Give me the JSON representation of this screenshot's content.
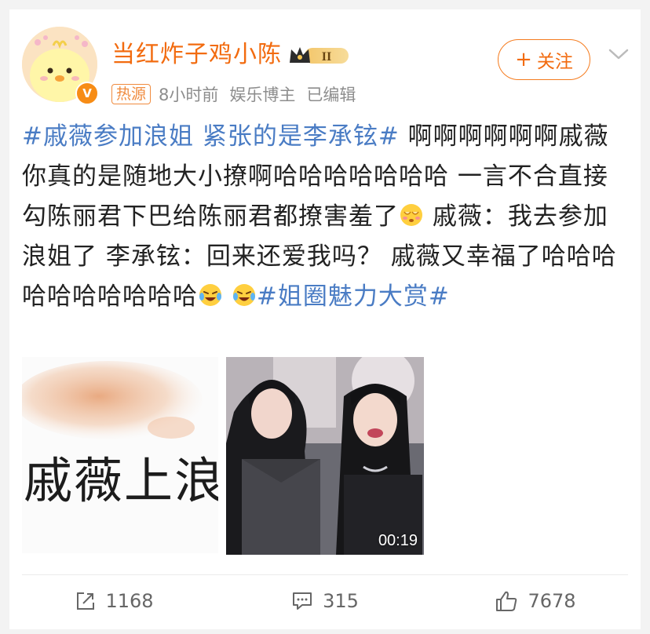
{
  "header": {
    "username": "当红炸子鸡小陈",
    "rank_badge": "II",
    "avatar_badge": "V",
    "hot_tag": "热源",
    "time": "8小时前",
    "role": "娱乐博主",
    "edited": "已编辑",
    "follow_label": "关注",
    "follow_plus": "+"
  },
  "post": {
    "tag1": "#戚薇参加浪姐 紧张的是李承铉#",
    "text1": " 啊啊啊啊啊啊戚薇你真的是随地大小撩啊哈哈哈哈哈哈哈 一言不合直接勾陈丽君下巴给陈丽君都撩害羞了",
    "text2": " 戚薇：我去参加浪姐了 李承铉：回来还爱我吗？ 戚薇又幸福了哈哈哈哈哈哈哈哈哈哈",
    "tag2": "#姐圈魅力大赏#",
    "emoji_shy": "shy-face-emoji",
    "emoji_laugh": "laughing-tears-emoji"
  },
  "media": {
    "left_caption": "戚薇上浪姐",
    "video_duration": "00:19"
  },
  "footer": {
    "repost_count": "1168",
    "comment_count": "315",
    "like_count": "7678"
  },
  "colors": {
    "accent": "#f26b0f",
    "link": "#4a7cc4",
    "meta": "#8d8d8d"
  }
}
